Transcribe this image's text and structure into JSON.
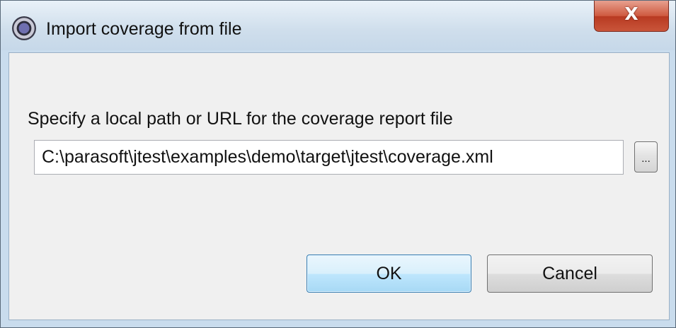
{
  "window": {
    "title": "Import coverage from file",
    "app_icon": "gear-icon",
    "close_label": "X"
  },
  "form": {
    "prompt": "Specify a local path or URL for the coverage report file",
    "path_value": "C:\\parasoft\\jtest\\examples\\demo\\target\\jtest\\coverage.xml",
    "browse_label": "..."
  },
  "buttons": {
    "ok_label": "OK",
    "cancel_label": "Cancel"
  }
}
